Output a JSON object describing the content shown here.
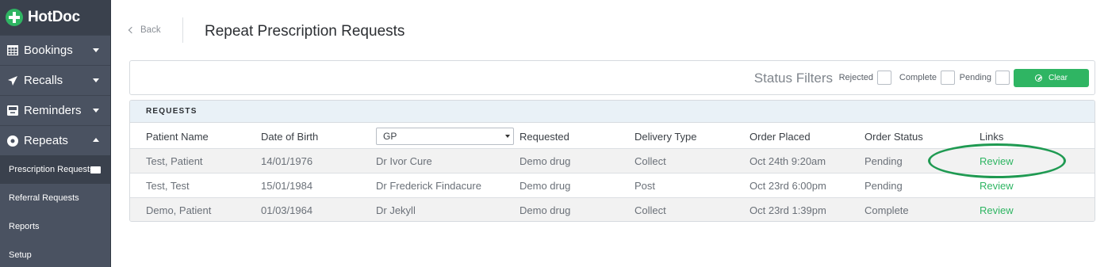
{
  "brand": {
    "name": "HotDoc",
    "accent": "#2fb563"
  },
  "sidebar": {
    "items": [
      {
        "label": "Bookings",
        "icon": "calendar-icon",
        "expanded": false
      },
      {
        "label": "Recalls",
        "icon": "paper-plane-icon",
        "expanded": false
      },
      {
        "label": "Reminders",
        "icon": "inbox-icon",
        "expanded": false
      },
      {
        "label": "Repeats",
        "icon": "disc-icon",
        "expanded": true
      }
    ],
    "subitems": [
      {
        "label": "Prescription Requests",
        "active": true,
        "icon": "envelope-icon"
      },
      {
        "label": "Referral Requests"
      },
      {
        "label": "Reports"
      },
      {
        "label": "Setup"
      }
    ]
  },
  "header": {
    "back_label": "Back",
    "title": "Repeat Prescription Requests"
  },
  "filters": {
    "label": "Status Filters",
    "options": [
      "Rejected",
      "Complete",
      "Pending"
    ],
    "clear_label": "Clear"
  },
  "requests": {
    "section_title": "REQUESTS",
    "columns": [
      "Patient Name",
      "Date of Birth",
      "GP",
      "Requested",
      "Delivery Type",
      "Order Placed",
      "Order Status",
      "Links"
    ],
    "rows": [
      [
        "Test, Patient",
        "14/01/1976",
        "Dr Ivor Cure",
        "Demo drug",
        "Collect",
        "Oct 24th 9:20am",
        "Pending",
        "Review"
      ],
      [
        "Test, Test",
        "15/01/1984",
        "Dr Frederick Findacure",
        "Demo drug",
        "Post",
        "Oct 23rd 6:00pm",
        "Pending",
        "Review"
      ],
      [
        "Demo, Patient",
        "01/03/1964",
        "Dr Jekyll",
        "Demo drug",
        "Collect",
        "Oct 23rd 1:39pm",
        "Complete",
        "Review"
      ]
    ]
  }
}
